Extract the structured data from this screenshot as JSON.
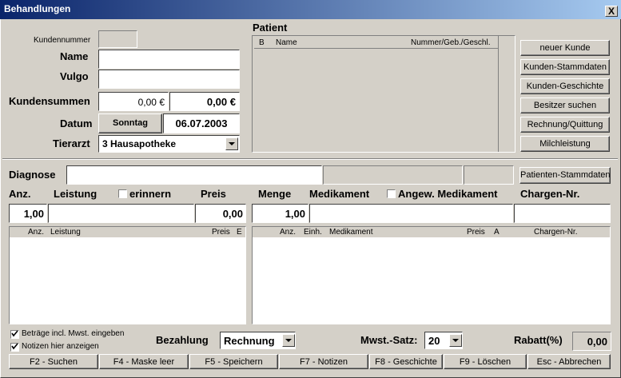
{
  "window": {
    "title": "Behandlungen",
    "close_glyph": "X"
  },
  "customer": {
    "kundennummer_label": "Kundennummer",
    "name_label": "Name",
    "vulgo_label": "Vulgo",
    "kundensummen_label": "Kundensummen",
    "sum1": "0,00 €",
    "sum2": "0,00 €",
    "datum_label": "Datum",
    "weekday": "Sonntag",
    "date": "06.07.2003",
    "tierarzt_label": "Tierarzt",
    "tierarzt_value": "3  Hausapotheke"
  },
  "patient": {
    "label": "Patient",
    "columns": [
      "B",
      "Name",
      "Nummer/Geb./Geschl."
    ]
  },
  "side_buttons": [
    "neuer Kunde",
    "Kunden-Stammdaten",
    "Kunden-Geschichte",
    "Besitzer suchen",
    "Rechnung/Quittung",
    "Milchleistung"
  ],
  "diagnose": {
    "label": "Diagnose",
    "patienten_button": "Patienten-Stammdaten"
  },
  "left_entry": {
    "anz_label": "Anz.",
    "leistung_label": "Leistung",
    "erinnern_label": "erinnern",
    "preis_label": "Preis",
    "anz_value": "1,00",
    "preis_value": "0,00",
    "columns": [
      "Anz.",
      "Leistung",
      "Preis",
      "E"
    ]
  },
  "right_entry": {
    "menge_label": "Menge",
    "medikament_label": "Medikament",
    "angew_label": "Angew. Medikament",
    "chargen_label": "Chargen-Nr.",
    "menge_value": "1,00",
    "columns": [
      "Anz.",
      "Einh.",
      "Medikament",
      "Preis",
      "A",
      "Chargen-Nr."
    ]
  },
  "bottom": {
    "check1": "Beträge incl. Mwst. eingeben",
    "check2": "Notizen hier anzeigen",
    "bezahlung_label": "Bezahlung",
    "bezahlung_value": "Rechnung",
    "mwst_label": "Mwst.-Satz:",
    "mwst_value": "20",
    "rabatt_label": "Rabatt(%)",
    "rabatt_value": "0,00"
  },
  "fkeys": [
    "F2 - Suchen",
    "F4 - Maske leer",
    "F5 - Speichern",
    "F7 - Notizen",
    "F8 - Geschichte",
    "F9 - Löschen",
    "Esc - Abbrechen"
  ],
  "icons": {
    "check": "check-icon",
    "dropdown": "chevron-down-icon",
    "close": "close-icon"
  }
}
